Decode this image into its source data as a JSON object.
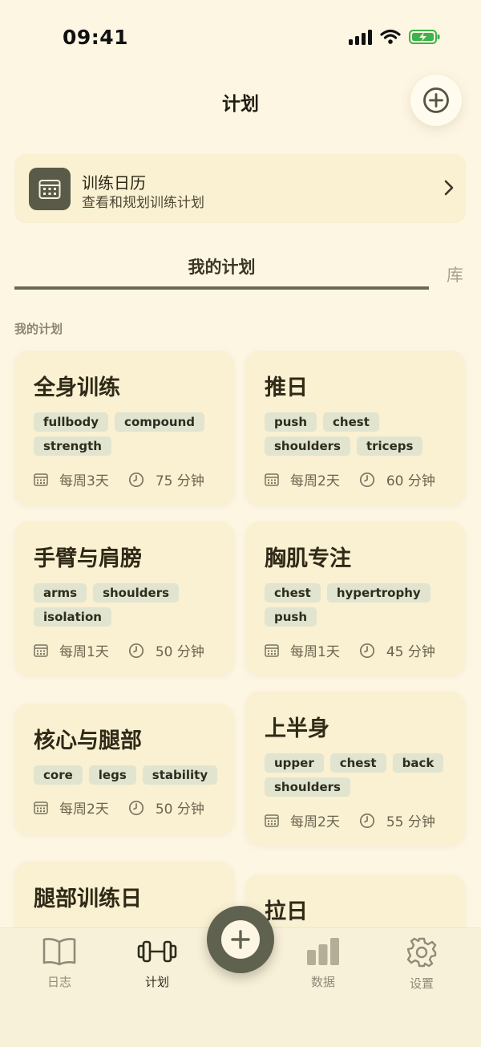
{
  "status": {
    "time": "09:41"
  },
  "header": {
    "title": "计划"
  },
  "calendar": {
    "title": "训练日历",
    "subtitle": "查看和规划训练计划"
  },
  "tabs": [
    {
      "label": "我的计划"
    },
    {
      "label": "库"
    }
  ],
  "section": {
    "label": "我的计划"
  },
  "plans": [
    {
      "name": "全身训练",
      "tags": [
        "fullbody",
        "compound",
        "strength"
      ],
      "frequency": "每周3天",
      "duration": "75 分钟"
    },
    {
      "name": "推日",
      "tags": [
        "push",
        "chest",
        "shoulders",
        "triceps"
      ],
      "frequency": "每周2天",
      "duration": "60 分钟"
    },
    {
      "name": "手臂与肩膀",
      "tags": [
        "arms",
        "shoulders",
        "isolation"
      ],
      "frequency": "每周1天",
      "duration": "50 分钟"
    },
    {
      "name": "胸肌专注",
      "tags": [
        "chest",
        "hypertrophy",
        "push"
      ],
      "frequency": "每周1天",
      "duration": "45 分钟"
    },
    {
      "name": "核心与腿部",
      "tags": [
        "core",
        "legs",
        "stability"
      ],
      "frequency": "每周2天",
      "duration": "50 分钟"
    },
    {
      "name": "上半身",
      "tags": [
        "upper",
        "chest",
        "back",
        "shoulders"
      ],
      "frequency": "每周2天",
      "duration": "55 分钟"
    },
    {
      "name": "腿部训练日"
    },
    {
      "name": "拉日"
    }
  ],
  "nav": [
    {
      "label": "日志",
      "icon": "book-icon"
    },
    {
      "label": "计划",
      "icon": "dumbbell-icon",
      "active": true
    },
    {
      "label": "数据",
      "icon": "bar-chart-icon"
    },
    {
      "label": "设置",
      "icon": "gear-icon"
    }
  ],
  "colors": {
    "background": "#fdf6e3",
    "card": "#faf0d2",
    "tag": "#e1e5cf",
    "accent": "#606250"
  }
}
